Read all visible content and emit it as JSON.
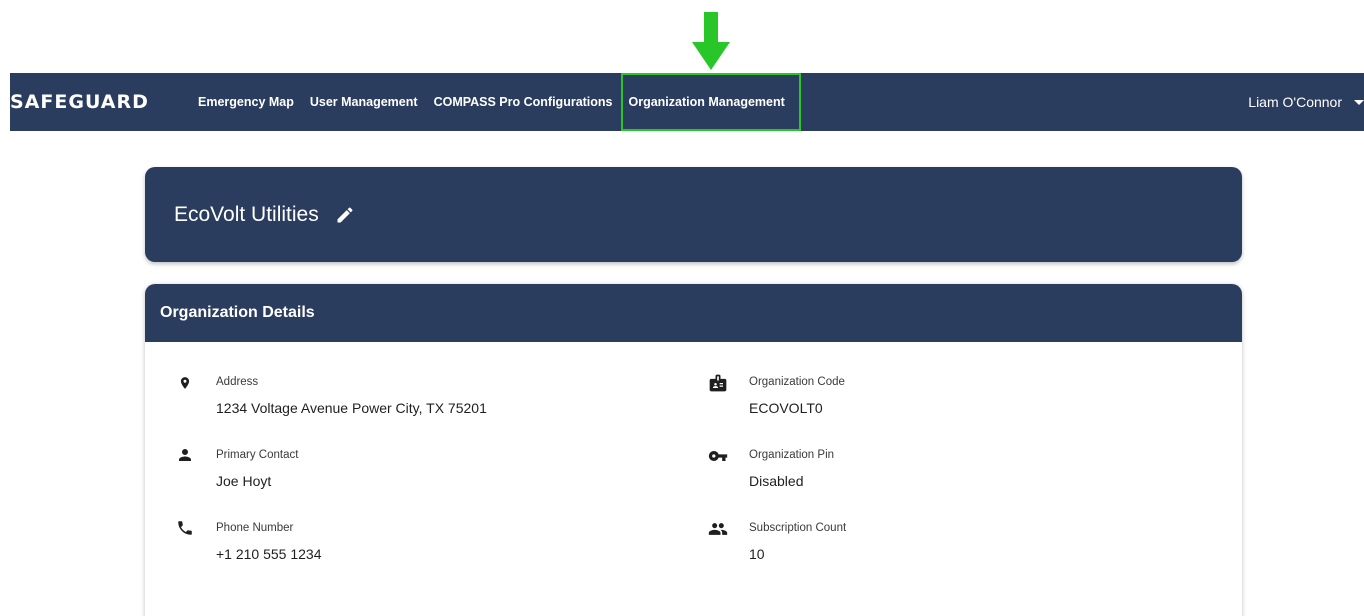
{
  "navbar": {
    "brand": "SAFEGUARD",
    "links": [
      {
        "label": "Emergency Map"
      },
      {
        "label": "User Management"
      },
      {
        "label": "COMPASS Pro Configurations"
      },
      {
        "label": "Organization Management"
      }
    ],
    "user_name": "Liam O'Connor"
  },
  "organization": {
    "name": "EcoVolt Utilities"
  },
  "details": {
    "title": "Organization Details",
    "address_label": "Address",
    "address_value": "1234 Voltage Avenue Power City, TX 75201",
    "contact_label": "Primary Contact",
    "contact_value": "Joe Hoyt",
    "phone_label": "Phone Number",
    "phone_value": "+1 210 555 1234",
    "code_label": "Organization Code",
    "code_value": "ECOVOLT0",
    "pin_label": "Organization Pin",
    "pin_value": "Disabled",
    "subscription_label": "Subscription Count",
    "subscription_value": "10"
  },
  "colors": {
    "primary": "#2b3d5e",
    "highlight": "#28c628"
  },
  "icons": {
    "address": "location-pin-icon",
    "contact": "person-icon",
    "phone": "phone-icon",
    "code": "badge-icon",
    "pin": "key-icon",
    "subscription": "group-icon",
    "edit": "pencil-icon"
  }
}
